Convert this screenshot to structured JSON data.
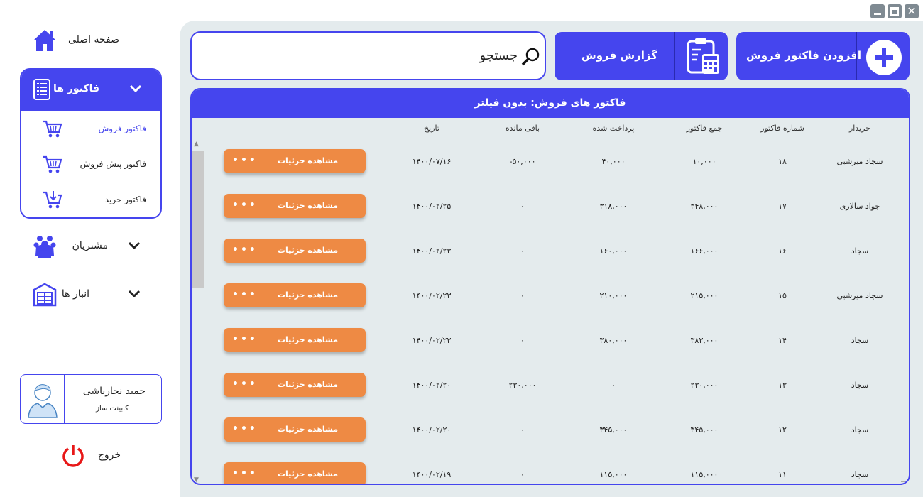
{
  "window": {
    "close_glyph": "✕"
  },
  "sidebar": {
    "home_label": "صفحه اصلی",
    "invoices_label": "فاکتور ها",
    "sub_items": [
      {
        "label": "فاکتور فروش",
        "active": true
      },
      {
        "label": "فاکتور پیش فروش",
        "active": false
      },
      {
        "label": "فاکتور خرید",
        "active": false
      }
    ],
    "customers_label": "مشتریان",
    "warehouses_label": "انبار ها",
    "user": {
      "name": "حمید نجارباشی",
      "role": "کابینت ساز"
    },
    "exit_label": "خروج"
  },
  "toolbar": {
    "search_label": "جستجو",
    "report_label": "گزارش فروش",
    "add_invoice_label": "افزودن فاکتور فروش"
  },
  "panel": {
    "title": "فاکتور های فروش: بدون فیلتر",
    "columns": [
      "خریدار",
      "شماره فاکتور",
      "جمع فاکتور",
      "پرداخت شده",
      "باقی مانده",
      "تاریخ"
    ],
    "details_label": "مشاهده جزئیات",
    "dots": "•••",
    "rows": [
      {
        "buyer": "سجاد میرشبی",
        "number": "۱۸",
        "total": "۱۰,۰۰۰",
        "paid": "۴۰,۰۰۰",
        "remaining": "-۵۰,۰۰۰",
        "date": "۱۴۰۰/۰۷/۱۶"
      },
      {
        "buyer": "جواد سالاری",
        "number": "۱۷",
        "total": "۳۴۸,۰۰۰",
        "paid": "۳۱۸,۰۰۰",
        "remaining": "۰",
        "date": "۱۴۰۰/۰۲/۲۵"
      },
      {
        "buyer": "سجاد",
        "number": "۱۶",
        "total": "۱۶۶,۰۰۰",
        "paid": "۱۶۰,۰۰۰",
        "remaining": "۰",
        "date": "۱۴۰۰/۰۲/۲۳"
      },
      {
        "buyer": "سجاد میرشبی",
        "number": "۱۵",
        "total": "۲۱۵,۰۰۰",
        "paid": "۲۱۰,۰۰۰",
        "remaining": "۰",
        "date": "۱۴۰۰/۰۲/۲۳"
      },
      {
        "buyer": "سجاد",
        "number": "۱۴",
        "total": "۳۸۳,۰۰۰",
        "paid": "۳۸۰,۰۰۰",
        "remaining": "۰",
        "date": "۱۴۰۰/۰۲/۲۳"
      },
      {
        "buyer": "سجاد",
        "number": "۱۳",
        "total": "۲۳۰,۰۰۰",
        "paid": "۰",
        "remaining": "۲۳۰,۰۰۰",
        "date": "۱۴۰۰/۰۲/۲۰"
      },
      {
        "buyer": "سجاد",
        "number": "۱۲",
        "total": "۳۴۵,۰۰۰",
        "paid": "۳۴۵,۰۰۰",
        "remaining": "۰",
        "date": "۱۴۰۰/۰۲/۲۰"
      },
      {
        "buyer": "سجاد",
        "number": "۱۱",
        "total": "۱۱۵,۰۰۰",
        "paid": "۱۱۵,۰۰۰",
        "remaining": "۰",
        "date": "۱۴۰۰/۰۲/۱۹"
      }
    ]
  },
  "colors": {
    "accent": "#4545ee",
    "button_orange": "#ee8a44",
    "panel_bg": "#e4ebed",
    "exit_red": "#e81818"
  }
}
